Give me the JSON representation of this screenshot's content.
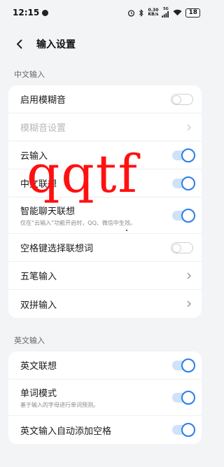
{
  "status": {
    "time": "12:15",
    "net_speed_top": "0.30",
    "net_speed_bottom": "KB/s",
    "network": "5G",
    "battery": "18"
  },
  "header": {
    "title": "输入设置"
  },
  "section_chinese": {
    "title": "中文输入",
    "fuzzy_toggle": "启用模糊音",
    "fuzzy_settings": "模糊音设置",
    "cloud_input": "云输入",
    "chinese_association": "中文联想",
    "smart_chat_title": "智能聊天联想",
    "smart_chat_sub": "仅在“云输入”功能开启时，QQ、微信中生效。",
    "space_select": "空格键选择联想词",
    "wubi": "五笔输入",
    "shuangpin": "双拼输入"
  },
  "section_english": {
    "title": "英文输入",
    "english_association": "英文联想",
    "word_mode_title": "单词模式",
    "word_mode_sub": "基于输入的字母进行单词预测。",
    "auto_space": "英文输入自动添加空格"
  },
  "overlay": {
    "text": "qqtf",
    "color": "#ff1010"
  },
  "colors": {
    "accent": "#2b7de9",
    "toggle_track_on": "#cfe2fb",
    "background": "#f3f4f6"
  }
}
